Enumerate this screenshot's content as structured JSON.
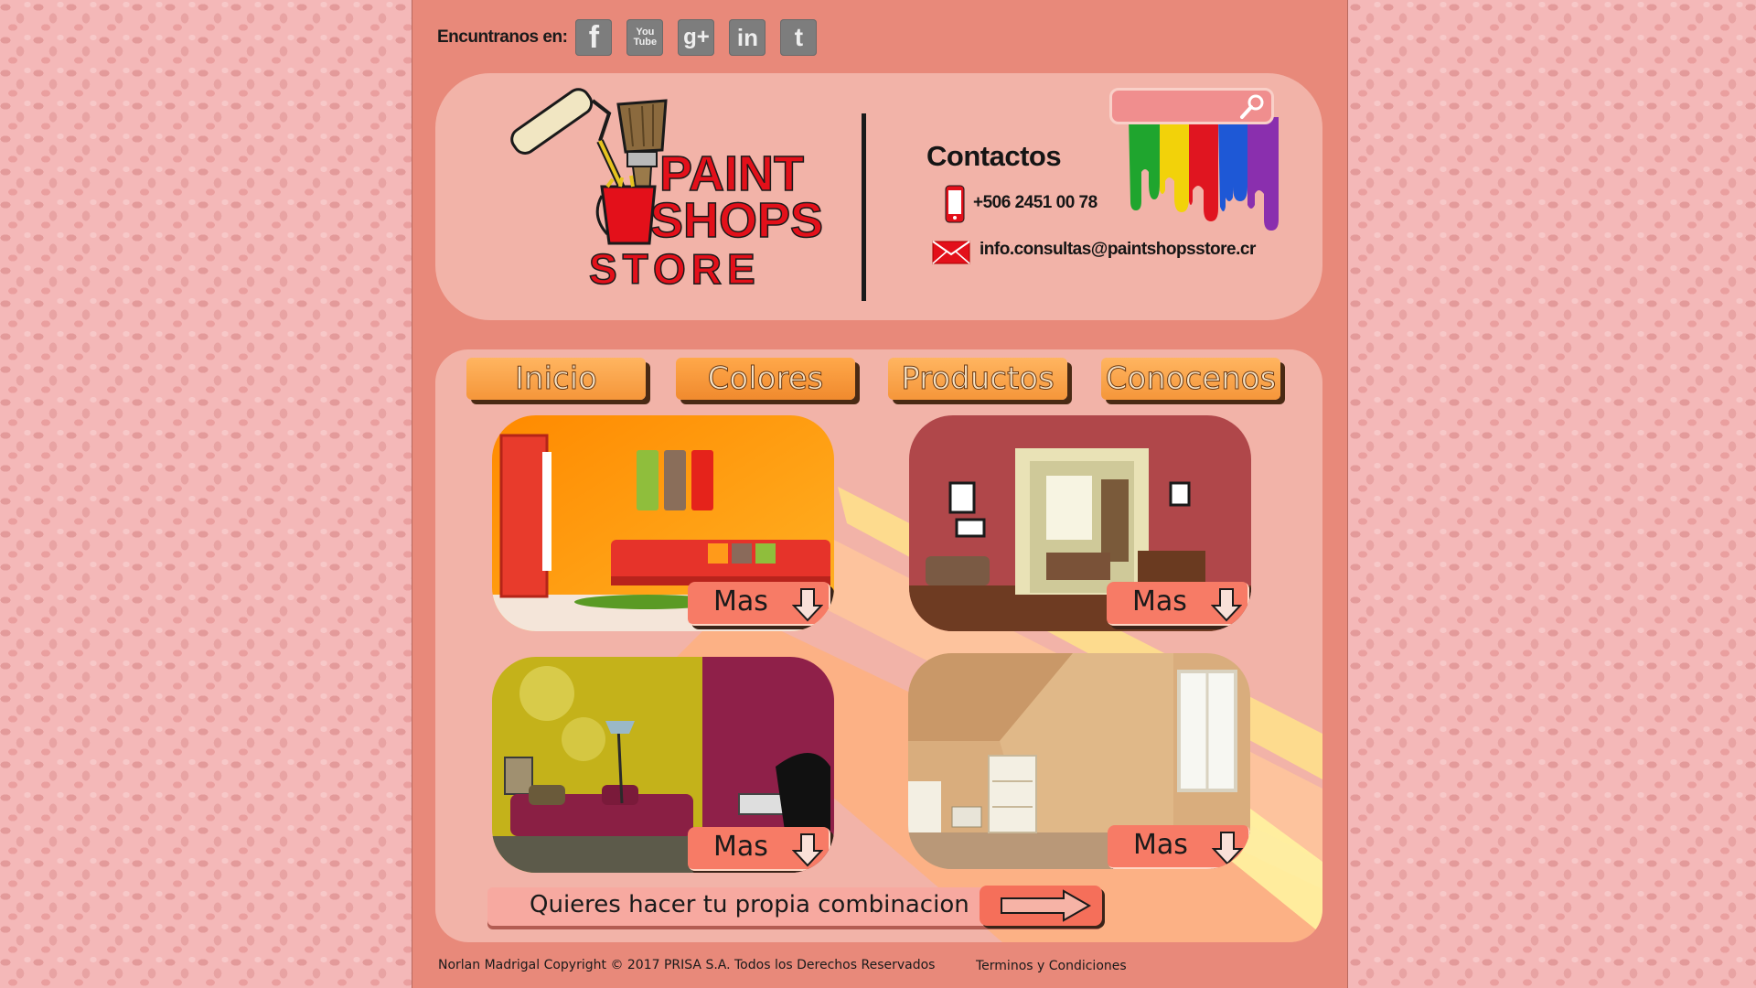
{
  "social": {
    "label": "Encuntranos en:",
    "icons": [
      {
        "name": "facebook-icon",
        "glyph": "f"
      },
      {
        "name": "youtube-icon",
        "glyph": "You Tube"
      },
      {
        "name": "google-plus-icon",
        "glyph": "g+"
      },
      {
        "name": "linkedin-icon",
        "glyph": "in"
      },
      {
        "name": "twitter-icon",
        "glyph": "t"
      }
    ]
  },
  "logo": {
    "line1": "PAINT",
    "line2": "SHOPS",
    "line3": "STORE"
  },
  "contact": {
    "title": "Contactos",
    "phone": "+506 2451 00 78",
    "email": "info.consultas@paintshopsstore.cr"
  },
  "search": {
    "placeholder": ""
  },
  "nav": {
    "inicio": "Inicio",
    "colores": "Colores",
    "productos": "Productos",
    "conocenos": "Conocenos"
  },
  "cards": {
    "mas_label": "Mas"
  },
  "combo": {
    "label": "Quieres hacer tu propia combinacion"
  },
  "footer": {
    "copyright": "Norlan Madrigal Copyright © 2017 PRISA S.A. Todos los Derechos Reservados",
    "terms": "Terminos y Condiciones"
  },
  "colors": {
    "page": "#e8897a",
    "panel": "#f2b3a8",
    "nav": "#f5963a",
    "mas": "#f77b66",
    "logo_red": "#e3101a"
  }
}
